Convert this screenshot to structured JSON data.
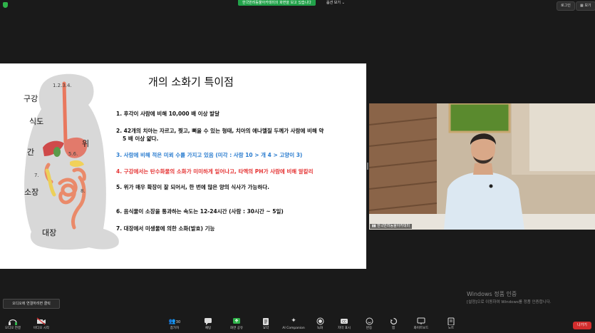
{
  "top_bar": {
    "share_banner": "한국반려동물아카데미의 화면을 보고 있습니다",
    "view_options": "옵션 보기 ⌄",
    "login_label": "로그인",
    "view_label": "보기"
  },
  "slide": {
    "title": "개의 소화기 특이점",
    "dog_labels": {
      "n1234": "1.2.3.4.",
      "mouth": "구강",
      "esophagus": "식도",
      "stomach": "위",
      "n56": "5.6.",
      "liver": "간",
      "n7": "7.",
      "small_intestine": "소장",
      "n8": "8.",
      "large_intestine": "대장"
    },
    "points": [
      "1. 후각이 사람에 비해 10,000 배 이상 발달",
      "2. 42개의 치아는 자르고, 찢고, 뼈을 수 있는 형태, 치아의 에나멜질 두께가 사람에 비해 약",
      "5 배 이상 얇다.",
      "3. 사람에 비해 적은 미뢰 수를 가지고 있음 (미각 : 사람 10 > 개 4 > 고양이 3)",
      "4. 구강에서는 탄수화물의 소화가 미미하게 일어나고, 타액의 PH가 사람에 비해 알칼리",
      "5. 위가 매우 확장이 잘 되어서, 한 번에 많은 양의 식사가 가능하다.",
      "6. 음식물이 소장을 통과하는 속도는 12-24시간 (사람 : 30시간 ~ 5일)",
      "7. 대장에서 미생물에 의한 소화(발효) 기능"
    ]
  },
  "video": {
    "participant_name": "한국반려동물아카데미"
  },
  "watermark": {
    "line1": "Windows 정품 인증",
    "line2": "[설정]으로 이동하여 Windows를 정품 인증합니다."
  },
  "tooltip": "오디오에 연결하려면 클릭",
  "toolbar": {
    "audio": "오디오 연결",
    "video": "비디오 시작",
    "participants": "참가자",
    "participants_count": "30",
    "chat": "채팅",
    "share": "화면 공유",
    "summary": "요약",
    "ai": "AI Companion",
    "record": "녹화",
    "captions": "자막 표시",
    "reactions": "반응",
    "apps": "앱",
    "whiteboard": "화이트보드",
    "notes": "노트",
    "leave": "나가기"
  },
  "colors": {
    "share_green": "#22a24a",
    "blue_text": "#2a7ccf",
    "red_text": "#e53434",
    "leave_red": "#d12d2d"
  }
}
